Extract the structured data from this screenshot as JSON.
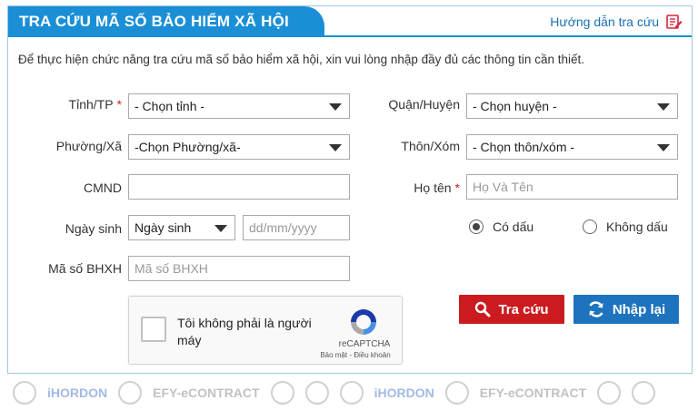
{
  "header": {
    "title": "TRA CỨU MÃ SỐ BẢO HIỂM XÃ HỘI",
    "guide_link": "Hướng dẫn tra cứu"
  },
  "intro": "Để thực hiện chức năng tra cứu mã số bảo hiểm xã hội, xin vui lòng nhập đầy đủ các thông tin cần thiết.",
  "form": {
    "province": {
      "label": "Tỉnh/TP",
      "required_mark": "*",
      "value": "- Chọn tỉnh -"
    },
    "district": {
      "label": "Quận/Huyện",
      "value": "- Chọn huyện -"
    },
    "ward": {
      "label": "Phường/Xã",
      "value": "-Chọn Phường/xã-"
    },
    "village": {
      "label": "Thôn/Xóm",
      "value": "- Chọn thôn/xóm -"
    },
    "id_card": {
      "label": "CMND",
      "value": "",
      "placeholder": ""
    },
    "fullname": {
      "label": "Họ tên",
      "required_mark": "*",
      "value": "",
      "placeholder": "Họ Và Tên"
    },
    "birthdate": {
      "label": "Ngày sinh",
      "type_value": "Ngày sinh",
      "value": "",
      "placeholder": "dd/mm/yyyy"
    },
    "accent": {
      "option_on": "Có dấu",
      "option_off": "Không dấu",
      "selected": "Có dấu"
    },
    "social_code": {
      "label": "Mã số BHXH",
      "value": "",
      "placeholder": "Mã số BHXH"
    }
  },
  "captcha": {
    "text": "Tôi không phải là người máy",
    "brand": "reCAPTCHA",
    "links": "Bảo mật - Điều khoản"
  },
  "buttons": {
    "search": "Tra cứu",
    "reset": "Nhập lại"
  },
  "colors": {
    "primary": "#1a8fd6",
    "search_button": "#cc1b1f",
    "reset_button": "#1e73be",
    "required": "#e11b1b"
  },
  "footer": {
    "logos": [
      "iHORDON",
      "EFY-eCONTRACT",
      "iHORDON",
      "EFY-eCONTRACT"
    ]
  }
}
